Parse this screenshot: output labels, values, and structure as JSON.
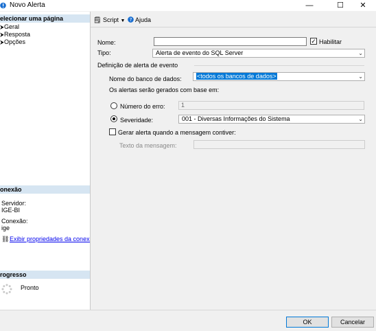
{
  "window": {
    "title": "Novo Alerta",
    "minimize": "—",
    "maximize": "☐",
    "close": "✕"
  },
  "sidebar": {
    "select_page_header": "elecionar uma página",
    "pages": [
      {
        "label": "Geral"
      },
      {
        "label": "Resposta"
      },
      {
        "label": "Opções"
      }
    ],
    "connection_header": "onexão",
    "server_label": "Servidor:",
    "server_value": "IGE-BI",
    "connection_label": "Conexão:",
    "connection_value": "ige",
    "view_props_link": "Exibir propriedades da conexã",
    "progress_header": "rogresso",
    "progress_status": "Pronto"
  },
  "toolbar": {
    "script_label": "Script",
    "help_label": "Ajuda"
  },
  "form": {
    "name_label": "Nome:",
    "name_value": "",
    "enable_label": "Habilitar",
    "enable_checked": true,
    "type_label": "Tipo:",
    "type_value": "Alerta de evento do SQL Server",
    "event_def_label": "Definição de alerta de evento",
    "db_name_label": "Nome do banco de dados:",
    "db_name_value": "<todos os bancos de dados>",
    "based_on_text": "Os alertas serão gerados com base em:",
    "error_number_label": "Número do erro:",
    "error_number_value": "1",
    "severity_label": "Severidade:",
    "severity_value": "001 - Diversas Informações do Sistema",
    "raise_when_label": "Gerar alerta quando a mensagem contiver:",
    "message_text_label": "Texto da mensagem:",
    "message_text_value": ""
  },
  "buttons": {
    "ok": "OK",
    "cancel": "Cancelar"
  },
  "colors": {
    "section_header_bg": "#d6e5f2",
    "selection_bg": "#0078d7",
    "link": "#0000ee"
  }
}
